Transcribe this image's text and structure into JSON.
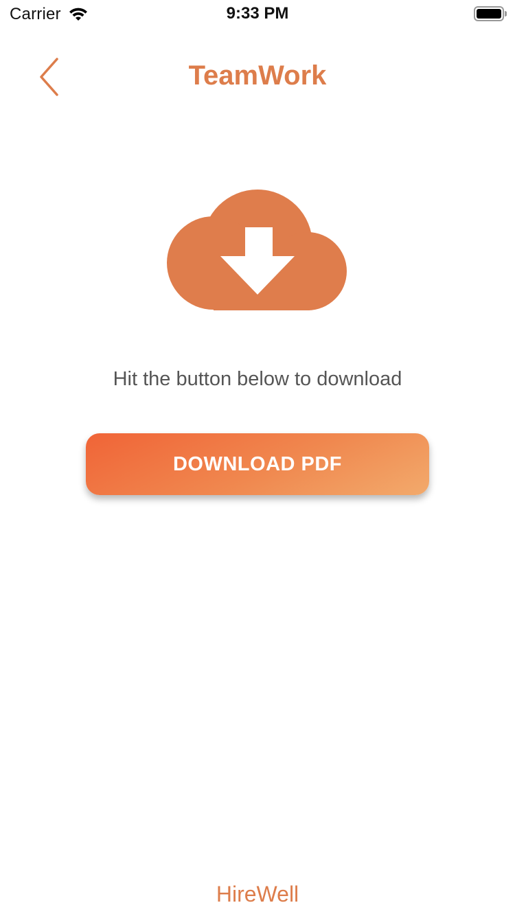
{
  "status_bar": {
    "carrier": "Carrier",
    "time": "9:33 PM",
    "wifi_icon": "wifi-icon",
    "battery_icon": "battery-icon"
  },
  "nav": {
    "title": "TeamWork",
    "back_icon": "chevron-left-icon"
  },
  "main": {
    "illustration": "cloud-download-icon",
    "instruction": "Hit the button below to download",
    "download_label": "DOWNLOAD PDF"
  },
  "footer": {
    "brand": "HireWell"
  },
  "colors": {
    "accent": "#DD7D4B",
    "button_gradient_start": "#F06437",
    "button_gradient_end": "#F2AA6C",
    "instruction_text": "#555555"
  }
}
